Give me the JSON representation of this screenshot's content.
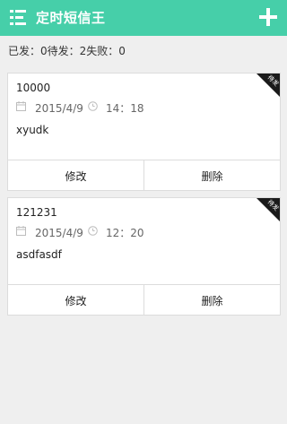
{
  "header": {
    "title": "定时短信王",
    "menu_icon": "menu-icon",
    "add_icon": "plus-icon"
  },
  "status": {
    "text": "已发：0待发：2失败：0"
  },
  "messages": [
    {
      "phone": "10000",
      "date": "2015/4/9",
      "time": "14：18",
      "content": "xyudk",
      "badge": "待发",
      "edit_label": "修改",
      "delete_label": "删除"
    },
    {
      "phone": "121231",
      "date": "2015/4/9",
      "time": "12：20",
      "content": "asdfasdf",
      "badge": "待发",
      "edit_label": "修改",
      "delete_label": "删除"
    }
  ],
  "colors": {
    "accent": "#46cfa9",
    "background": "#efefef"
  }
}
